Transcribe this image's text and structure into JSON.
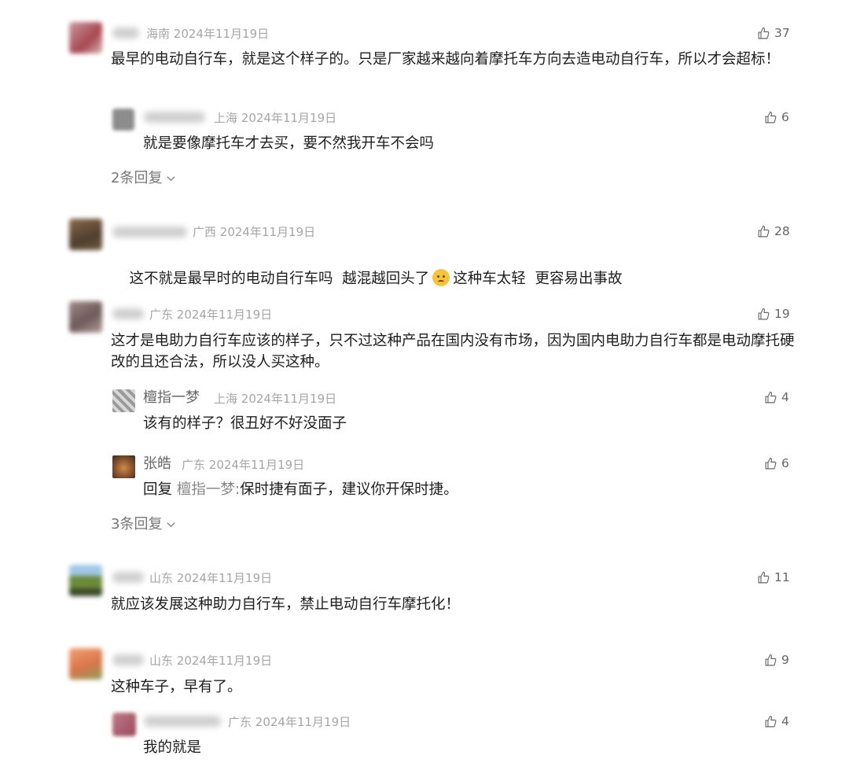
{
  "comments": [
    {
      "location": "海南",
      "date": "2024年11月19日",
      "likes": "37",
      "text": "最早的电动自行车，就是这个样子的。只是厂家越来越向着摩托车方向去造电动自行车，所以才会超标！",
      "avatar_color": "#b98a8f",
      "replies": [
        {
          "location": "上海",
          "date": "2024年11月19日",
          "likes": "6",
          "text": "就是要像摩托车才去买，要不然我开车不会吗"
        }
      ],
      "more_label": "2条回复"
    },
    {
      "location": "广西",
      "date": "2024年11月19日",
      "likes": "28",
      "text_a": "这不就是最早时的电动自行车吗  越混越回头了",
      "emoji": "confused-face-emoji",
      "text_b": "这种车太轻  更容易出事故",
      "avatar_color": "#6e5a46"
    },
    {
      "location": "广东",
      "date": "2024年11月19日",
      "likes": "19",
      "text": "这才是电助力自行车应该的样子，只不过这种产品在国内没有市场，因为国内电助力自行车都是电动摩托硬改的且还合法，所以没人买这种。",
      "avatar_color": "#8b7676",
      "replies": [
        {
          "name": "檀指一梦",
          "location": "上海",
          "date": "2024年11月19日",
          "likes": "4",
          "text": "该有的样子？很丑好不好没面子"
        },
        {
          "name": "张皓",
          "location": "广东",
          "date": "2024年11月19日",
          "likes": "6",
          "reply_prefix": "回复",
          "reply_to": "檀指一梦:",
          "text": "保时捷有面子，建议你开保时捷。"
        }
      ],
      "more_label": "3条回复"
    },
    {
      "location": "山东",
      "date": "2024年11月19日",
      "likes": "11",
      "text": "就应该发展这种助力自行车，禁止电动自行车摩托化！",
      "avatar_color": "#7a8a5a"
    },
    {
      "location": "山东",
      "date": "2024年11月19日",
      "likes": "9",
      "text": "这种车子，早有了。",
      "avatar_color": "#e0895a",
      "replies": [
        {
          "location": "广东",
          "date": "2024年11月19日",
          "likes": "4",
          "text": "我的就是"
        }
      ]
    }
  ],
  "icons": {
    "like": "thumbs-up-icon",
    "expand": "chevron-down-icon"
  }
}
